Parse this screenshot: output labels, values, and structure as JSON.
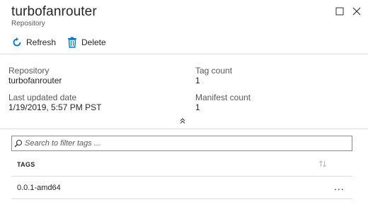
{
  "blade": {
    "title": "turbofanrouter",
    "subtitle": "Repository",
    "maximize_icon": "maximize-icon",
    "close_icon": "close-icon"
  },
  "toolbar": {
    "refresh_label": "Refresh",
    "refresh_icon": "refresh-icon",
    "delete_label": "Delete",
    "delete_icon": "trash-icon",
    "accent_color": "#0078d4"
  },
  "essentials": {
    "repository_label": "Repository",
    "repository_value": "turbofanrouter",
    "last_updated_label": "Last updated date",
    "last_updated_value": "1/19/2019, 5:57 PM PST",
    "tag_count_label": "Tag count",
    "tag_count_value": "1",
    "manifest_count_label": "Manifest count",
    "manifest_count_value": "1"
  },
  "filter": {
    "placeholder": "Search to filter tags ..."
  },
  "table": {
    "headers": [
      "TAGS"
    ],
    "rows": [
      {
        "tag": "0.0.1-amd64",
        "actions": "..."
      }
    ]
  }
}
